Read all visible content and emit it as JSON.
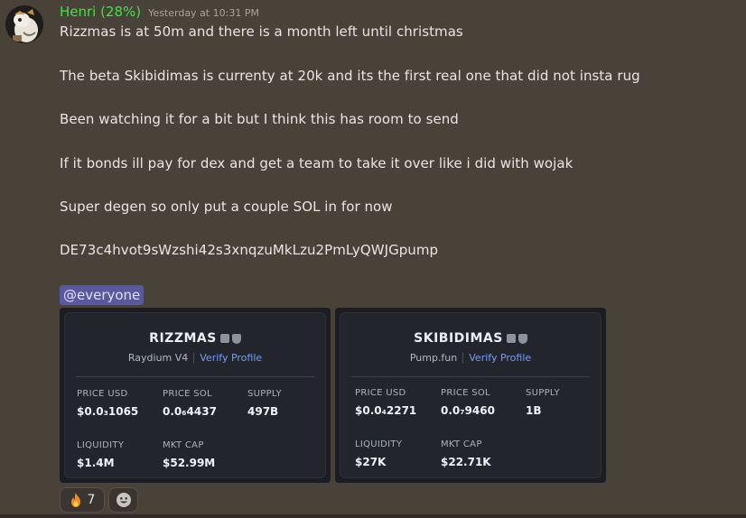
{
  "message": {
    "username": "Henri (28%)",
    "timestamp": "Yesterday at 10:31 PM",
    "lines": [
      "Rizzmas is at 50m and there is a month left until christmas",
      "The beta Skibidimas is currenty at 20k and its the first real one that did not insta rug",
      "Been watching it for a bit but I think this has room to send",
      "If it bonds ill pay for dex and get a team to take it over like i did with wojak",
      "Super degen so only put a couple SOL in for now",
      "DE73c4hvot9sWzshi42s3xnqzuMkLzu2PmLyQWJGpump"
    ],
    "mention": "@everyone"
  },
  "cards": [
    {
      "name": "RIZZMAS",
      "platform": "Raydium V4",
      "verify_label": "Verify Profile",
      "stats": {
        "price_usd_label": "PRICE USD",
        "price_usd": "$0.0₃1065",
        "price_sol_label": "PRICE SOL",
        "price_sol": "0.0₆4437",
        "supply_label": "SUPPLY",
        "supply": "497B",
        "liquidity_label": "LIQUIDITY",
        "liquidity": "$1.4M",
        "mkt_cap_label": "MKT CAP",
        "mkt_cap": "$52.99M"
      }
    },
    {
      "name": "SKIBIDIMAS",
      "platform": "Pump.fun",
      "verify_label": "Verify Profile",
      "stats": {
        "price_usd_label": "PRICE USD",
        "price_usd": "$0.0₄2271",
        "price_sol_label": "PRICE SOL",
        "price_sol": "0.0₇9460",
        "supply_label": "SUPPLY",
        "supply": "1B",
        "liquidity_label": "LIQUIDITY",
        "liquidity": "$27K",
        "mkt_cap_label": "MKT CAP",
        "mkt_cap": "$22.71K"
      }
    }
  ],
  "reactions": [
    {
      "icon": "fire-icon",
      "count": "7"
    },
    {
      "icon": "add-reaction-icon"
    }
  ],
  "colors": {
    "background": "#494239",
    "username": "#43e043",
    "mention_bg": "#59599e",
    "verify_link": "#7c9cf0",
    "card_bg": "#22252c"
  }
}
